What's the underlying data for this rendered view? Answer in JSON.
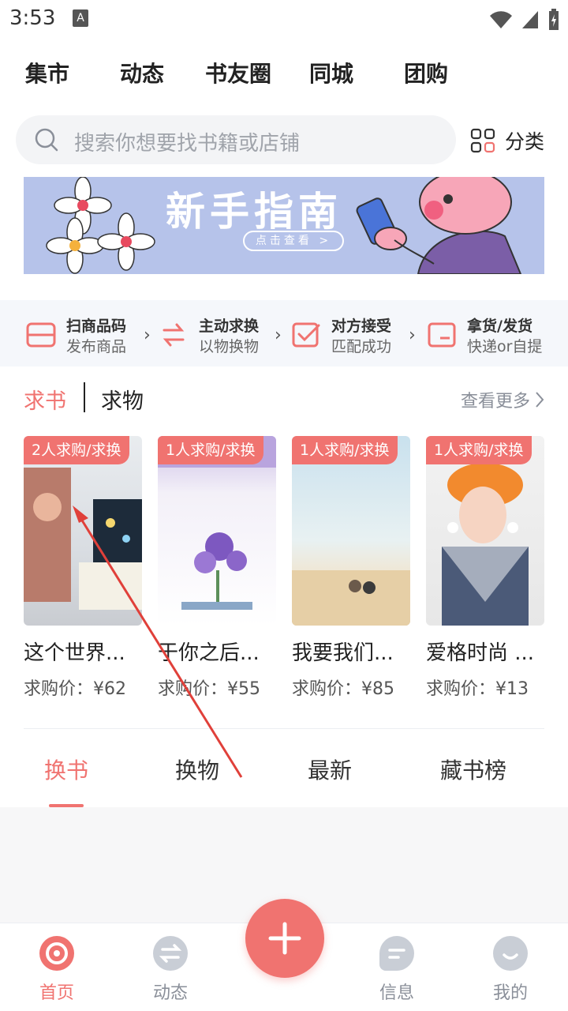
{
  "status": {
    "time": "3:53",
    "badge": "A"
  },
  "top_tabs": [
    "集市",
    "动态",
    "书友圈",
    "同城",
    "团购"
  ],
  "search": {
    "placeholder": "搜索你想要找书籍或店铺"
  },
  "category": {
    "label": "分类"
  },
  "banner": {
    "title": "新手指南",
    "cta": "点击查看 >"
  },
  "steps": [
    {
      "title": "扫商品码",
      "sub": "发布商品"
    },
    {
      "title": "主动求换",
      "sub": "以物换物"
    },
    {
      "title": "对方接受",
      "sub": "匹配成功"
    },
    {
      "title": "拿货/发货",
      "sub": "快递or自提"
    }
  ],
  "seek": {
    "tab_books": "求书",
    "tab_goods": "求物",
    "see_more": "查看更多"
  },
  "books": [
    {
      "badge": "2人求购/求换",
      "title": "这个世界...",
      "price": "求购价：¥62"
    },
    {
      "badge": "1人求购/求换",
      "title": "于你之后...",
      "price": "求购价：¥55"
    },
    {
      "badge": "1人求购/求换",
      "title": "我要我们...",
      "price": "求购价：¥85"
    },
    {
      "badge": "1人求购/求换",
      "title": "爱格时尚 ...",
      "price": "求购价：¥13"
    }
  ],
  "bottom_tabs": [
    "换书",
    "换物",
    "最新",
    "藏书榜"
  ],
  "nav": [
    "首页",
    "动态",
    "信息",
    "我的"
  ],
  "colors": {
    "accent": "#f07370",
    "banner_bg": "#b6c3ea"
  }
}
